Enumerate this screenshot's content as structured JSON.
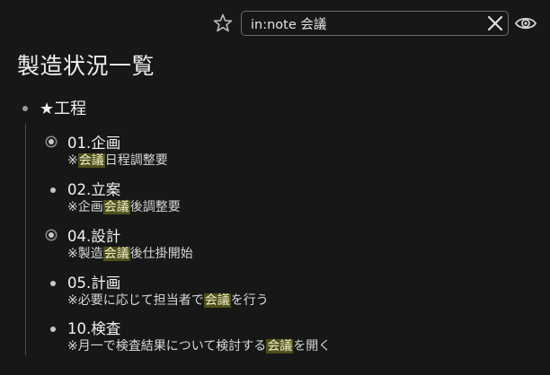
{
  "search": {
    "value": "in:note 会議",
    "placeholder": ""
  },
  "icons": {
    "star": "star-outline-icon",
    "clear": "close-icon",
    "preview": "eye-icon"
  },
  "page": {
    "title": "製造状況一覧"
  },
  "outline": {
    "root": {
      "label": "★工程"
    },
    "children": [
      {
        "title": "01.企画",
        "note_pre": "※",
        "note_match": "会議",
        "note_post": "日程調整要",
        "collapsed": true
      },
      {
        "title": "02.立案",
        "note_pre": "※企画",
        "note_match": "会議",
        "note_post": "後調整要",
        "collapsed": false
      },
      {
        "title": "04.設計",
        "note_pre": "※製造",
        "note_match": "会議",
        "note_post": "後仕掛開始",
        "collapsed": true
      },
      {
        "title": "05.計画",
        "note_pre": "※必要に応じて担当者で",
        "note_match": "会議",
        "note_post": "を行う",
        "collapsed": false
      },
      {
        "title": "10.検査",
        "note_pre": "※月一で検査結果について検討する",
        "note_match": "会議",
        "note_post": "を開く",
        "collapsed": false
      }
    ]
  },
  "colors": {
    "background": "#161817",
    "highlight": "#4f4f1c"
  }
}
